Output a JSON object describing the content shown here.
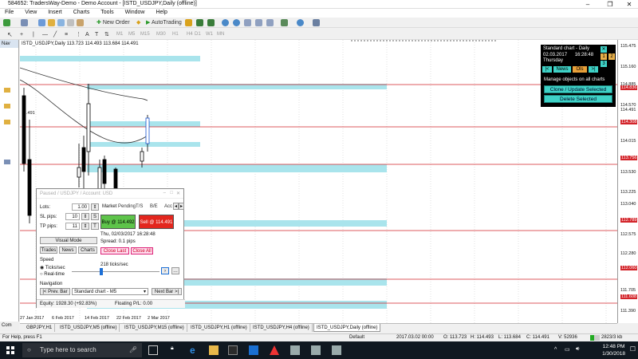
{
  "window": {
    "title": "584652: TradersWay-Demo - Demo Account - [ISTD_USDJPY,Daily (offline)]"
  },
  "menu": [
    "File",
    "View",
    "Insert",
    "Charts",
    "Tools",
    "Window",
    "Help"
  ],
  "toolbar": {
    "new_order": "New Order",
    "autotrading": "AutoTrading",
    "timeframes": [
      "M1",
      "M5",
      "M15",
      "M30",
      "H1",
      "H4",
      "D1",
      "W1",
      "MN"
    ]
  },
  "navigator": {
    "label": "Nav"
  },
  "chart": {
    "info": "ISTD_USDJPY,Daily  113.723 114.493 113.684 114.491",
    "left_marker": ".491",
    "price_labels": [
      {
        "text": "115.475",
        "red": false
      },
      {
        "text": "115.160",
        "red": false
      },
      {
        "text": "114.885",
        "red": false
      },
      {
        "text": "114.836",
        "red": true
      },
      {
        "text": "114.570",
        "red": false
      },
      {
        "text": "114.491",
        "red": false
      },
      {
        "text": "114.308",
        "red": true
      },
      {
        "text": "114.015",
        "red": false
      },
      {
        "text": "113.756",
        "red": true
      },
      {
        "text": "113.530",
        "red": false
      },
      {
        "text": "113.225",
        "red": false
      },
      {
        "text": "113.040",
        "red": false
      },
      {
        "text": "112.789",
        "red": true
      },
      {
        "text": "112.575",
        "red": false
      },
      {
        "text": "112.280",
        "red": false
      },
      {
        "text": "112.060",
        "red": true
      },
      {
        "text": "111.705",
        "red": false
      },
      {
        "text": "111.608",
        "red": true
      },
      {
        "text": "111.390",
        "red": false
      }
    ],
    "date_labels": [
      "27 Jan 2017",
      "6 Feb 2017",
      "14 Feb 2017",
      "22 Feb 2017",
      "2 Mar 2017"
    ]
  },
  "std_panel": {
    "title": "Standard chart - Daily",
    "date": "02.03.2017",
    "time": "16:28:48",
    "weekday": "Thursday",
    "nav_prev": "|<",
    "news": "News",
    "ols": "Ols",
    "nav_next": ">|",
    "num1": "1",
    "num2": "2",
    "num3": "3",
    "manage_label": "Manage objects on all charts",
    "clone_btn": "Clone / Update Selected",
    "delete_btn": "Delete Selected"
  },
  "simulator": {
    "title": "Paused / USDJPY / Account: USD",
    "lots_label": "Lots:",
    "lots_value": "1.00",
    "sl_label": "SL pips:",
    "sl_value": "10",
    "tp_label": "TP pips:",
    "tp_value": "11",
    "tabs": [
      "Market",
      "Pending",
      "T/S",
      "B/E",
      "Acc"
    ],
    "buy_btn": "Buy @ 114.492",
    "sell_btn": "Sell @ 114.491",
    "datetime": "Thu, 02/03/2017  16:28:48",
    "spread": "Spread:  0.1 pips",
    "close_last": "Close Last",
    "close_all": "Close All",
    "visual_mode": "Visual Mode",
    "trades": "Trades",
    "news": "News",
    "charts": "Charts",
    "speed_label": "Speed",
    "ticks_radio": "Ticks/sec",
    "realtime_radio": "Real-time",
    "speed_value": "218 ticks/sec",
    "nav_label": "Navigation",
    "prev_bar": "|< Prev. Bar",
    "chart_select": "Standard chart - M5",
    "next_bar": "Next Bar >|",
    "equity": "Equity:  1928.30  (+92.83%)",
    "floating": "Floating P/L:  0.00"
  },
  "tabs": [
    "GBPJPY,H1",
    "ISTD_USDJPY,M5 (offline)",
    "ISTD_USDJPY,M15 (offline)",
    "ISTD_USDJPY,H1 (offline)",
    "ISTD_USDJPY,H4 (offline)",
    "ISTD_USDJPY,Daily (offline)"
  ],
  "com_tab": "Com",
  "status": {
    "help": "For Help, press F1",
    "profile": "Default",
    "datetime": "2017.03.02 00:00",
    "open": "O: 113.723",
    "high": "H: 114.493",
    "low": "L: 113.684",
    "close": "C: 114.491",
    "volume": "V: 52936",
    "traffic": "2823/3 kb"
  },
  "taskbar": {
    "search_placeholder": "Type here to search",
    "time": "12:48 PM",
    "date": "1/30/2018"
  }
}
